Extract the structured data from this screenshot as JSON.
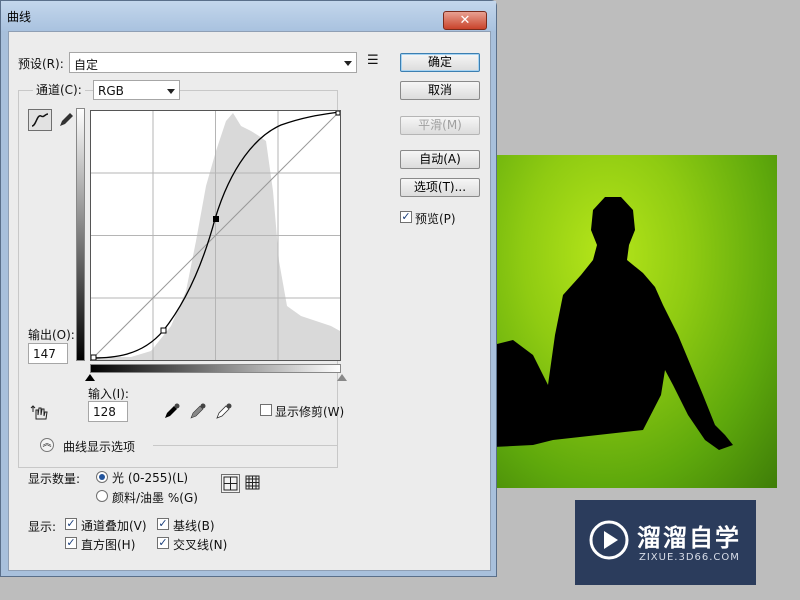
{
  "window": {
    "title": "曲线",
    "close_glyph": "✕"
  },
  "preset": {
    "label": "预设(R):",
    "value": "自定",
    "menu_glyph": "☰"
  },
  "channel": {
    "label": "通道(C):",
    "value": "RGB"
  },
  "buttons": {
    "ok": "确定",
    "cancel": "取消",
    "smooth": "平滑(M)",
    "auto": "自动(A)",
    "options": "选项(T)...",
    "preview_label": "预览(P)"
  },
  "output": {
    "label": "输出(O):",
    "value": "147"
  },
  "input": {
    "label": "输入(I):",
    "value": "128"
  },
  "show_clipping": "显示修剪(W)",
  "curve_display_options": "曲线显示选项",
  "show_amount": {
    "label": "显示数量:",
    "option_light": "光 (0-255)(L)",
    "option_pigment": "颜料/油墨 %(G)",
    "selected": "light"
  },
  "show": {
    "label": "显示:",
    "channel_overlays": "通道叠加(V)",
    "baseline": "基线(B)",
    "histogram": "直方图(H)",
    "intersection_line": "交叉线(N)"
  },
  "watermark": {
    "title": "溜溜自学",
    "subtitle": "ZIXUE.3D66.COM"
  },
  "checks": {
    "preview": true,
    "show_clipping": false,
    "channel_overlays": true,
    "baseline": true,
    "histogram": true,
    "intersection_line": true
  },
  "colors": {
    "accent": "#3c7fb1",
    "titlebar": "#a9c2df",
    "grass": "#8fcb12"
  }
}
